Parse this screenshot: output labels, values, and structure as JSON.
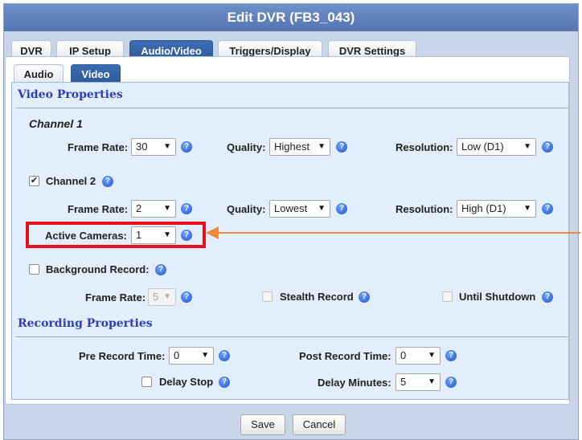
{
  "window": {
    "title": "Edit DVR (FB3_043)"
  },
  "main_tabs": [
    {
      "label": "DVR"
    },
    {
      "label": "IP Setup"
    },
    {
      "label": "Audio/Video"
    },
    {
      "label": "Triggers/Display"
    },
    {
      "label": "DVR Settings"
    }
  ],
  "sub_tabs": [
    {
      "label": "Audio"
    },
    {
      "label": "Video"
    }
  ],
  "video_properties": {
    "title": "Video Properties",
    "channel1": {
      "heading": "Channel 1",
      "frame_rate_label": "Frame Rate:",
      "frame_rate": "30",
      "quality_label": "Quality:",
      "quality": "Highest",
      "resolution_label": "Resolution:",
      "resolution": "Low (D1)"
    },
    "channel2": {
      "label": "Channel 2",
      "checked": true,
      "frame_rate_label": "Frame Rate:",
      "frame_rate": "2",
      "quality_label": "Quality:",
      "quality": "Lowest",
      "resolution_label": "Resolution:",
      "resolution": "High (D1)"
    },
    "active_cameras_label": "Active Cameras:",
    "active_cameras": "1",
    "background_record": {
      "label": "Background Record:",
      "checked": false,
      "frame_rate_label": "Frame Rate:",
      "frame_rate": "5",
      "stealth_label": "Stealth Record",
      "until_shutdown_label": "Until Shutdown"
    }
  },
  "recording_properties": {
    "title": "Recording Properties",
    "pre_record_label": "Pre Record Time:",
    "pre_record": "0",
    "post_record_label": "Post Record Time:",
    "post_record": "0",
    "delay_stop_label": "Delay Stop",
    "delay_minutes_label": "Delay Minutes:",
    "delay_minutes": "5"
  },
  "footer": {
    "save_label": "Save",
    "cancel_label": "Cancel"
  },
  "colors": {
    "title_bar": "#5f7fbd",
    "active_tab": "#2f5fa3",
    "section_title": "#2a3fb8",
    "highlight": "#e8101c",
    "callout_arrow": "#f0883a",
    "panel": "#e3eefc"
  }
}
